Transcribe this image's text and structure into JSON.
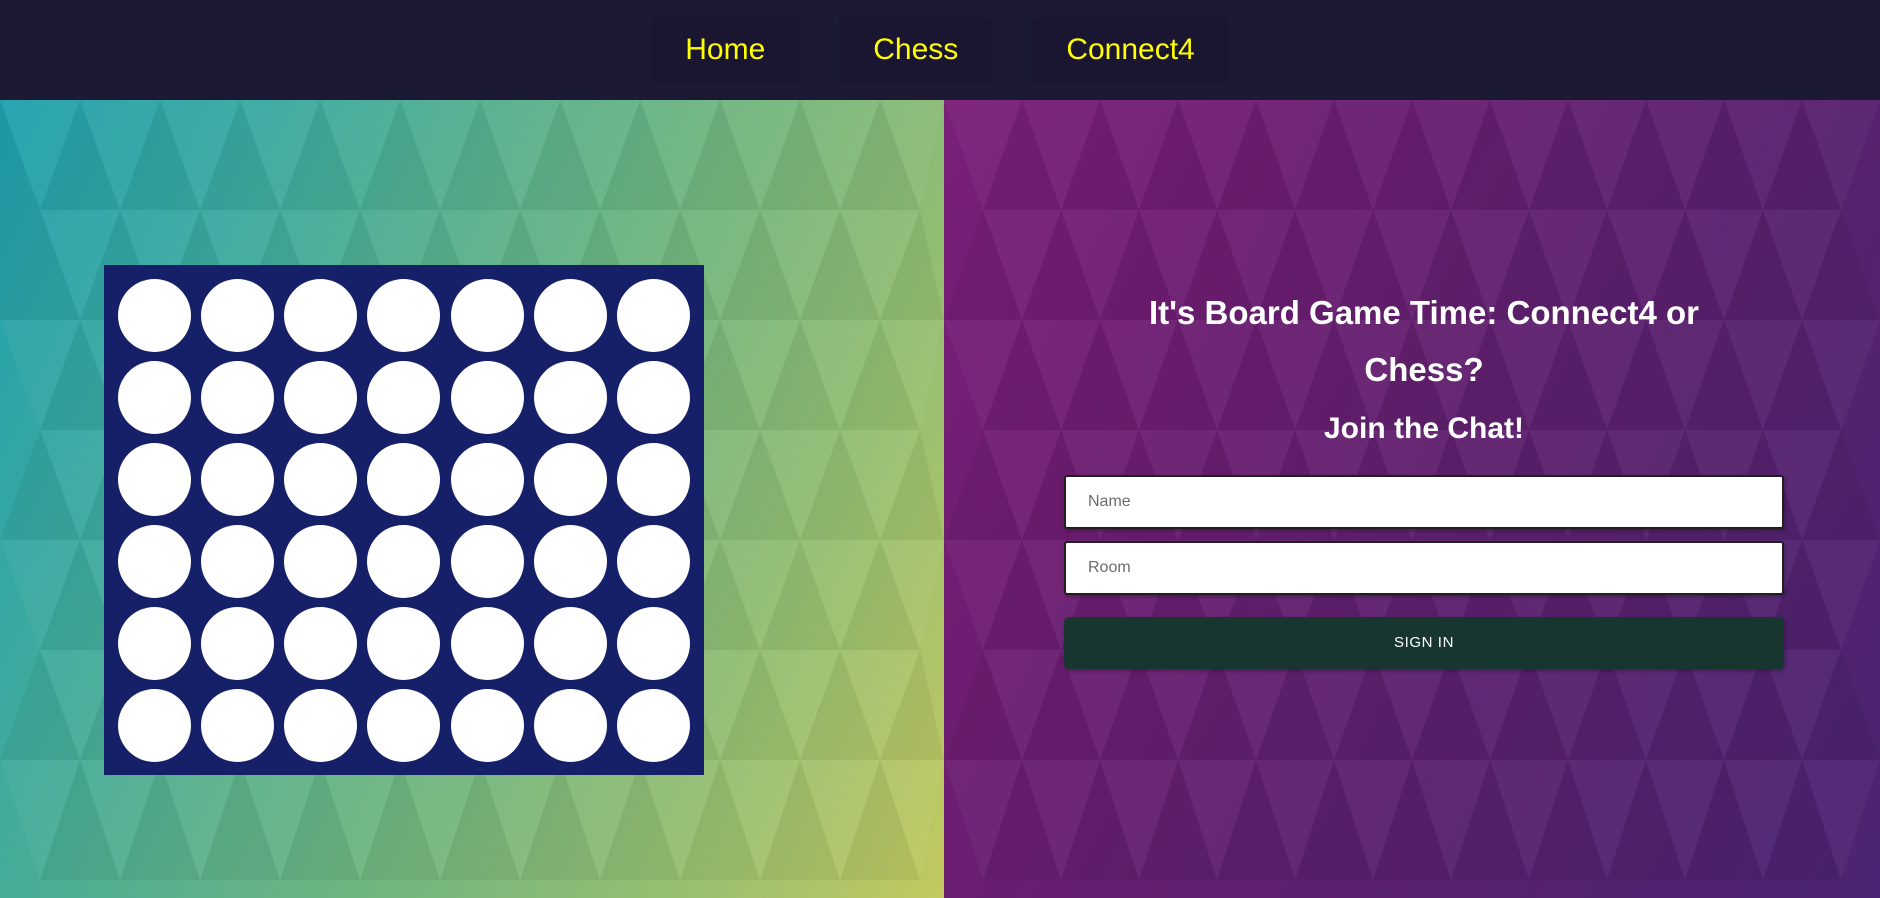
{
  "navbar": {
    "items": [
      {
        "label": "Home",
        "name": "nav-item-home"
      },
      {
        "label": "Chess",
        "name": "nav-item-chess"
      },
      {
        "label": "Connect4",
        "name": "nav-item-connect4"
      }
    ],
    "background_color": "#1c1934",
    "link_color": "#ffff00"
  },
  "left_panel": {
    "gradient_from": "#1fa0ad",
    "gradient_to": "#c3c95f",
    "board": {
      "name": "connect4-board",
      "rows": 6,
      "columns": 7,
      "board_color": "#152069",
      "empty_color": "#ffffff",
      "cells": [
        [
          "empty",
          "empty",
          "empty",
          "empty",
          "empty",
          "empty",
          "empty"
        ],
        [
          "empty",
          "empty",
          "empty",
          "empty",
          "empty",
          "empty",
          "empty"
        ],
        [
          "empty",
          "empty",
          "empty",
          "empty",
          "empty",
          "empty",
          "empty"
        ],
        [
          "empty",
          "empty",
          "empty",
          "empty",
          "empty",
          "empty",
          "empty"
        ],
        [
          "empty",
          "empty",
          "empty",
          "empty",
          "empty",
          "empty",
          "empty"
        ],
        [
          "empty",
          "empty",
          "empty",
          "empty",
          "empty",
          "empty",
          "empty"
        ]
      ]
    }
  },
  "right_panel": {
    "gradient_from": "#7a1f78",
    "gradient_to": "#4a2472",
    "headline": "It's Board Game Time: Connect4 or Chess?",
    "subhead": "Join the Chat!",
    "form": {
      "name_input": {
        "value": "",
        "placeholder": "Name"
      },
      "room_input": {
        "value": "",
        "placeholder": "Room"
      },
      "submit_label": "SIGN IN",
      "submit_color": "#16362f"
    }
  }
}
